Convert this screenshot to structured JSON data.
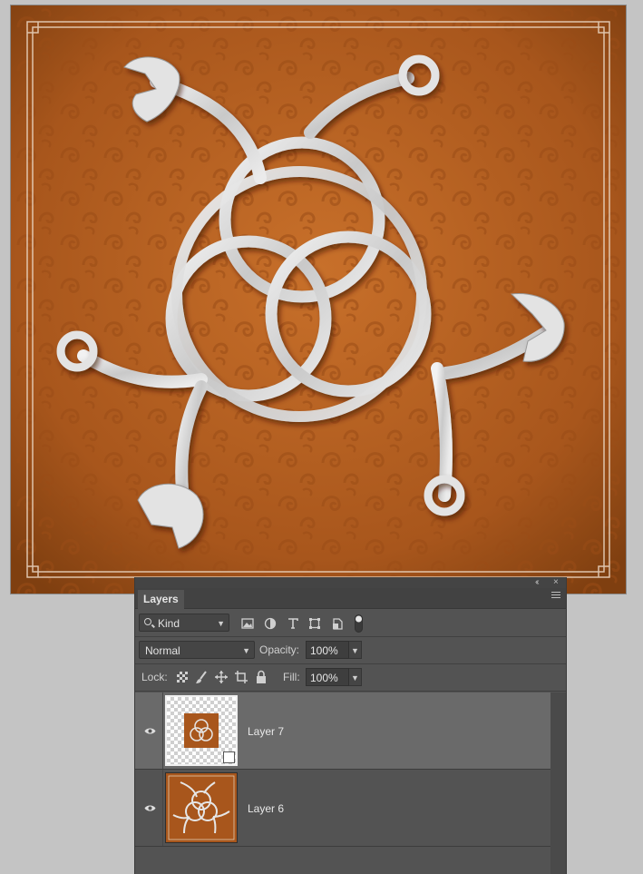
{
  "canvas": {
    "description_icon": "celtic-triquetra-wrench-artwork",
    "background_color": "#b5601f",
    "pattern_color": "#9a4c16",
    "frame_color": "#e8d2bd",
    "wrench_color": "#dcdcdc"
  },
  "panel": {
    "collapse_label": "‹‹",
    "close_label": "×",
    "tab_label": "Layers",
    "filter": {
      "kind_label": "Kind",
      "icons": [
        "image-filter-icon",
        "adjustment-filter-icon",
        "type-filter-icon",
        "shape-filter-icon",
        "smart-object-filter-icon"
      ]
    },
    "blend_mode": "Normal",
    "opacity_label": "Opacity:",
    "opacity_value": "100%",
    "lock_label": "Lock:",
    "fill_label": "Fill:",
    "fill_value": "100%"
  },
  "layers": [
    {
      "name": "Layer 7",
      "selected": true,
      "visible": true,
      "smart_object": true
    },
    {
      "name": "Layer 6",
      "selected": false,
      "visible": true,
      "smart_object": false
    }
  ],
  "colors": {
    "panel_bg": "#535353",
    "selected_row": "#6a6a6a",
    "workspace": "#c4c4c4"
  }
}
